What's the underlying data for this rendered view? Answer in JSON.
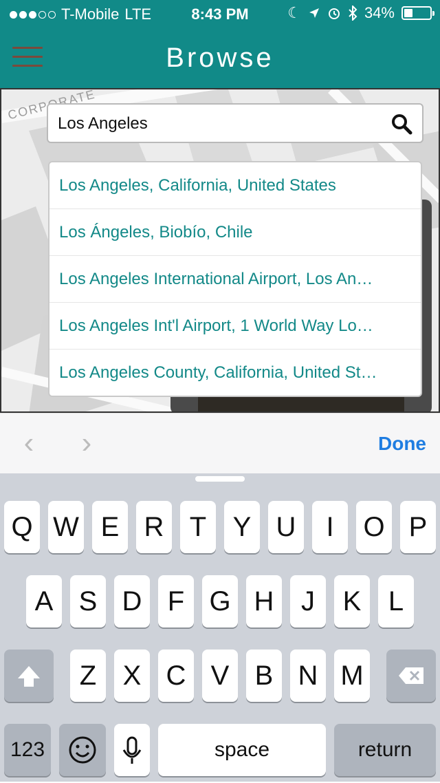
{
  "status_bar": {
    "carrier": "T-Mobile",
    "network": "LTE",
    "time": "8:43 PM",
    "battery": "34%",
    "signal_dots_on": 3,
    "signal_dots_total": 5,
    "icons": [
      "moon-icon",
      "location-arrow-icon",
      "alarm-icon",
      "bluetooth-icon",
      "battery-icon"
    ]
  },
  "nav": {
    "title": "Browse",
    "menu_icon": "hamburger-menu-icon"
  },
  "map": {
    "street_label": "CORPORATE"
  },
  "search": {
    "value": "Los Angeles",
    "icon": "search-icon"
  },
  "suggestions": [
    "Los Angeles, California, United States",
    "Los Ángeles, Biobío, Chile",
    "Los Angeles International Airport, Los An…",
    "Los Angeles Int'l Airport, 1 World Way Lo…",
    "Los Angeles County, California, United St…"
  ],
  "toolbar": {
    "prev_icon": "chevron-left-icon",
    "next_icon": "chevron-right-icon",
    "done_label": "Done"
  },
  "keyboard": {
    "row1": [
      "Q",
      "W",
      "E",
      "R",
      "T",
      "Y",
      "U",
      "I",
      "O",
      "P"
    ],
    "row2": [
      "A",
      "S",
      "D",
      "F",
      "G",
      "H",
      "J",
      "K",
      "L"
    ],
    "row3": [
      "Z",
      "X",
      "C",
      "V",
      "B",
      "N",
      "M"
    ],
    "numbers_label": "123",
    "space_label": "space",
    "return_label": "return",
    "shift_icon": "shift-icon",
    "delete_icon": "delete-icon",
    "emoji_icon": "emoji-icon",
    "mic_icon": "microphone-icon"
  },
  "colors": {
    "brand": "#118a88",
    "link": "#138988",
    "done": "#1f7de1",
    "keyboard_bg": "#ced2d9"
  }
}
